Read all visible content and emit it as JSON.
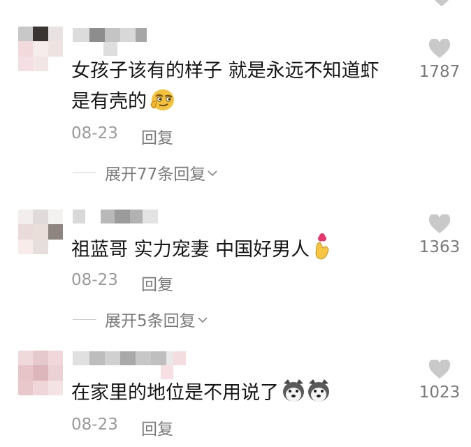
{
  "comments": [
    {
      "text_line1": "女孩子该有的样子 就是永远不知道虾",
      "text_line2": "是有壳的",
      "emoji": "smirk-emoji",
      "date": "08-23",
      "reply": "回复",
      "expand": "展开77条回复",
      "likes": "1787"
    },
    {
      "text_line1": "祖蓝哥 实力宠妻 中国好男人",
      "emoji": "finger-heart-emoji",
      "date": "08-23",
      "reply": "回复",
      "expand": "展开5条回复",
      "likes": "1363"
    },
    {
      "text_line1": "在家里的地位是不用说了",
      "emoji": "husky-dog-emoji",
      "date": "08-23",
      "reply": "回复",
      "likes": "1023"
    }
  ],
  "colors": {
    "text": "#161616",
    "meta": "#9a9a9a",
    "heart": "#c9c9c9"
  },
  "icons": [
    "heart-icon",
    "chevron-down-icon"
  ]
}
